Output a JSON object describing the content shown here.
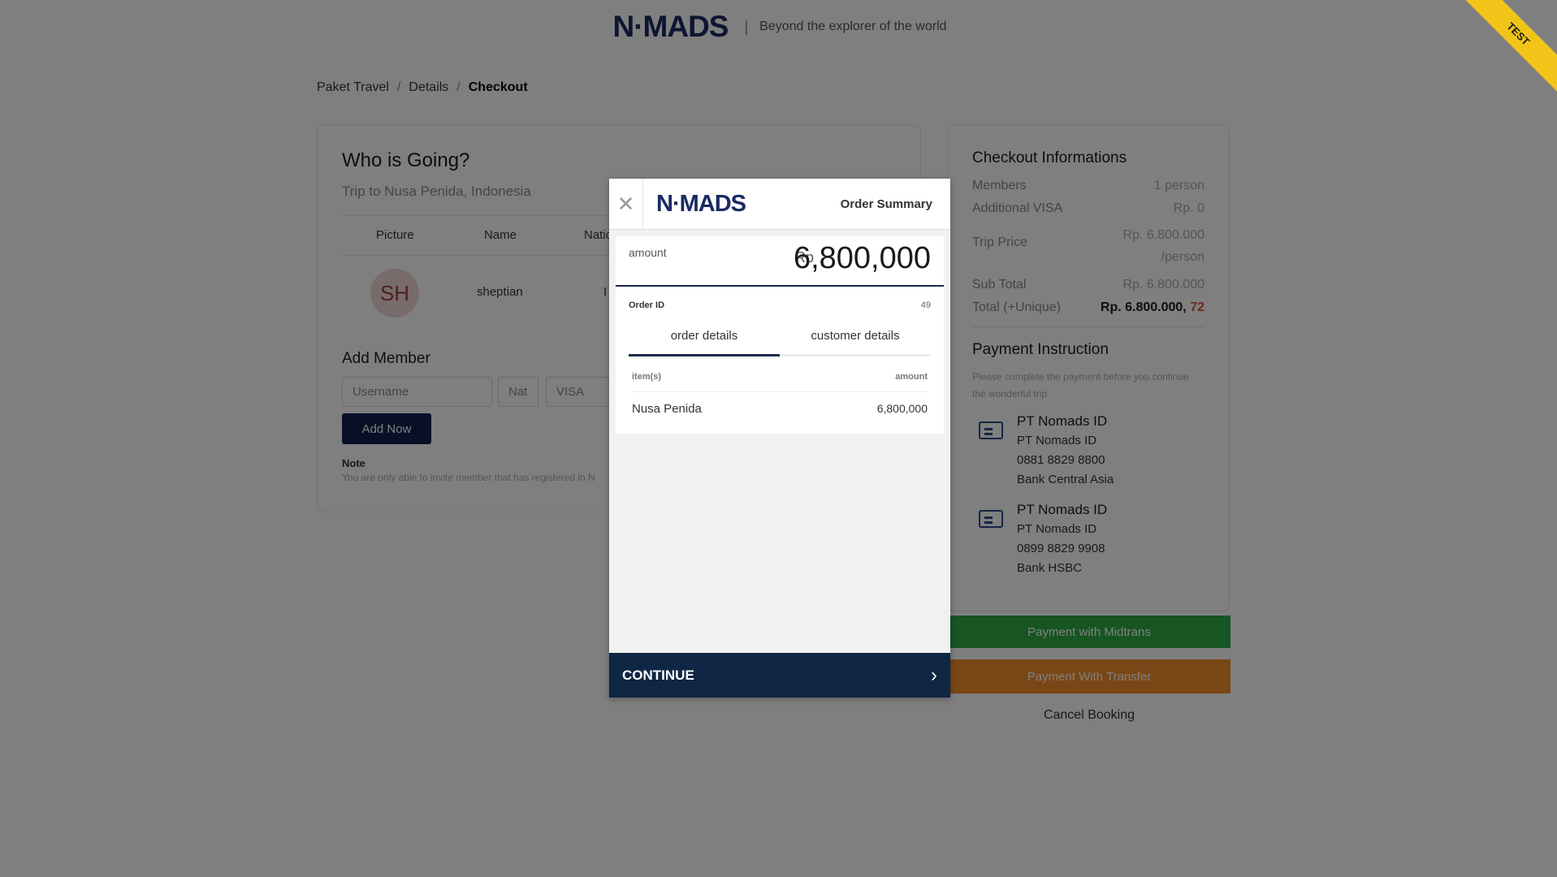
{
  "header": {
    "logo": "N·MADS",
    "tagline": "Beyond the explorer of the world"
  },
  "breadcrumb": [
    "Paket Travel",
    "Details",
    "Checkout"
  ],
  "who": {
    "title": "Who is Going?",
    "subtitle": "Trip to Nusa Penida, Indonesia",
    "columns": [
      "Picture",
      "Name",
      "Natio"
    ],
    "member": {
      "initials": "SH",
      "name": "sheptian",
      "nationality": "I"
    }
  },
  "add_member": {
    "title": "Add Member",
    "username_placeholder": "Username",
    "nat_placeholder": "Nat",
    "visa_value": "VISA",
    "button": "Add Now",
    "note_label": "Note",
    "note_text": "You are only able to invite member that has registered in N"
  },
  "checkout": {
    "title": "Checkout Informations",
    "members_label": "Members",
    "members_value": "1 person",
    "visa_label": "Additional VISA",
    "visa_value": "Rp. 0",
    "trip_label": "Trip Price",
    "trip_value": "Rp. 6.800.000",
    "trip_unit": "/person",
    "subtotal_label": "Sub Total",
    "subtotal_value": "Rp. 6.800.000",
    "total_label": "Total (+Unique)",
    "total_value": "Rp. 6.800.000,",
    "total_unique": "72"
  },
  "payment": {
    "title": "Payment Instruction",
    "note": "Please complete the payment before you continue the wonderful trip",
    "banks": [
      {
        "name": "PT Nomads ID",
        "holder": "PT Nomads ID",
        "account": "0881 8829 8800",
        "bank": "Bank Central Asia"
      },
      {
        "name": "PT Nomads ID",
        "holder": "PT Nomads ID",
        "account": "0899 8829 9908",
        "bank": "Bank HSBC"
      }
    ],
    "midtrans_button": "Payment with Midtrans",
    "transfer_button": "Payment With Transfer",
    "cancel": "Cancel Booking"
  },
  "ribbon": "TEST",
  "modal": {
    "logo": "N·MADS",
    "title": "Order Summary",
    "amount_label": "amount",
    "currency": "Rp",
    "amount": "6,800,000",
    "order_id_label": "Order ID",
    "order_id": "49",
    "tabs": [
      "order details",
      "customer details"
    ],
    "items_header": "item(s)",
    "amount_header": "amount",
    "item_name": "Nusa Penida",
    "item_amount": "6,800,000",
    "continue": "CONTINUE"
  },
  "icons": {
    "close": "close-icon",
    "chevron": "chevron-right-icon",
    "card": "credit-card-icon"
  }
}
